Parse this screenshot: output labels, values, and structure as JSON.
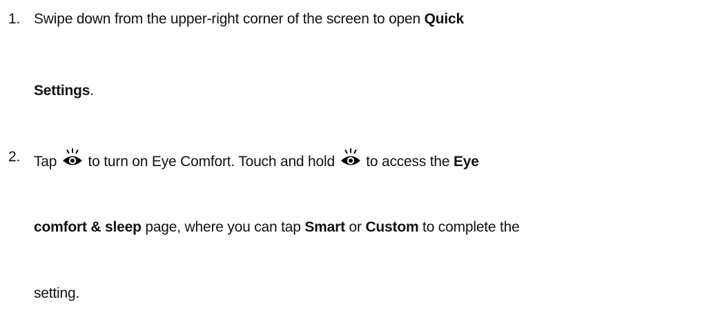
{
  "steps": [
    {
      "number": "1.",
      "text_a": "Swipe down from the upper-right corner of the screen to open ",
      "bold_a": "Quick",
      "bold_b": "Settings",
      "text_b": "."
    },
    {
      "number": "2.",
      "text_a": "Tap ",
      "icon_1": "eye-comfort-icon",
      "text_b": " to turn on Eye Comfort. Touch and hold ",
      "icon_2": "eye-comfort-icon",
      "text_c": " to access the ",
      "bold_a": "Eye",
      "bold_b": "comfort & sleep",
      "text_d": " page, where you can tap ",
      "bold_c": "Smart",
      "text_e": " or ",
      "bold_d": "Custom",
      "text_f": " to complete the",
      "text_g": "setting."
    }
  ]
}
